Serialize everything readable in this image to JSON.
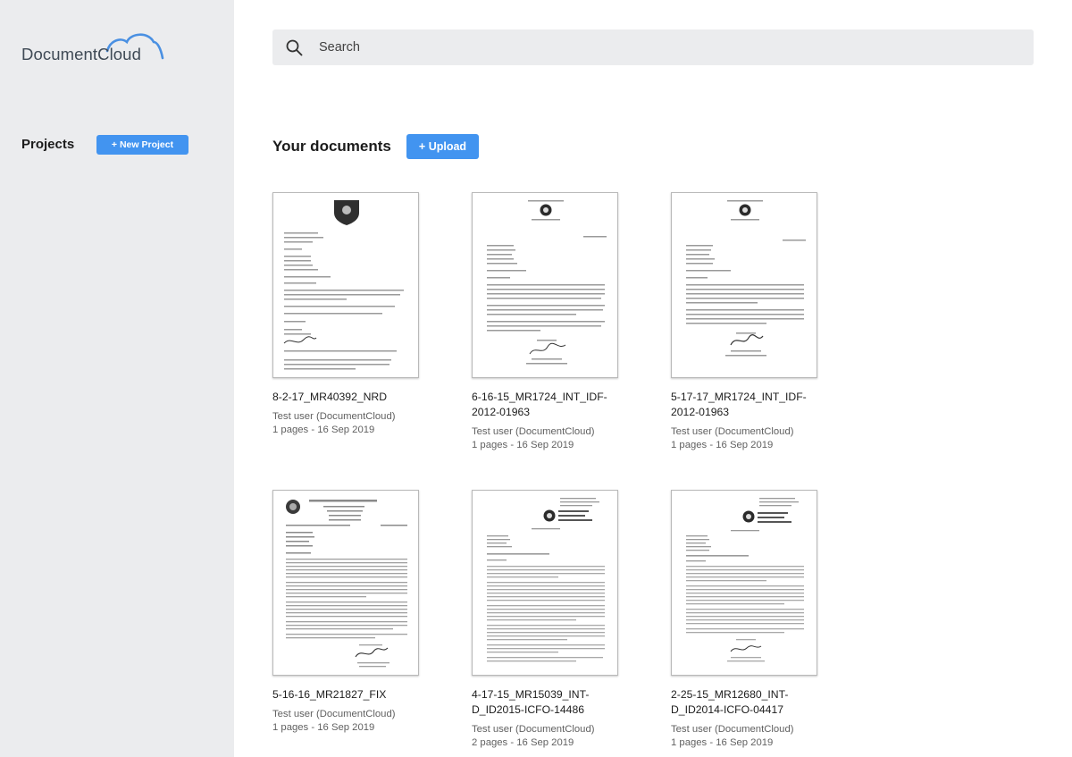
{
  "app": {
    "logo_text": "DocumentCloud",
    "accent_color": "#4294f0",
    "logo_cloud_color": "#4a90e2"
  },
  "sidebar": {
    "projects_label": "Projects",
    "new_project_label": "+ New Project"
  },
  "search": {
    "icon": "search-icon",
    "placeholder": "Search",
    "value": ""
  },
  "main": {
    "title": "Your documents",
    "upload_label": "+ Upload"
  },
  "documents": [
    {
      "title": "8-2-17_MR40392_NRD",
      "author": "Test user (DocumentCloud)",
      "info": "1 pages - 16 Sep 2019"
    },
    {
      "title": "6-16-15_MR1724_INT_IDF-2012-01963",
      "author": "Test user (DocumentCloud)",
      "info": "1 pages - 16 Sep 2019"
    },
    {
      "title": "5-17-17_MR1724_INT_IDF-2012-01963",
      "author": "Test user (DocumentCloud)",
      "info": "1 pages - 16 Sep 2019"
    },
    {
      "title": "5-16-16_MR21827_FIX",
      "author": "Test user (DocumentCloud)",
      "info": "1 pages - 16 Sep 2019"
    },
    {
      "title": "4-17-15_MR15039_INT-D_ID2015-ICFO-14486",
      "author": "Test user (DocumentCloud)",
      "info": "2 pages - 16 Sep 2019"
    },
    {
      "title": "2-25-15_MR12680_INT-D_ID2014-ICFO-04417",
      "author": "Test user (DocumentCloud)",
      "info": "1 pages - 16 Sep 2019"
    }
  ]
}
